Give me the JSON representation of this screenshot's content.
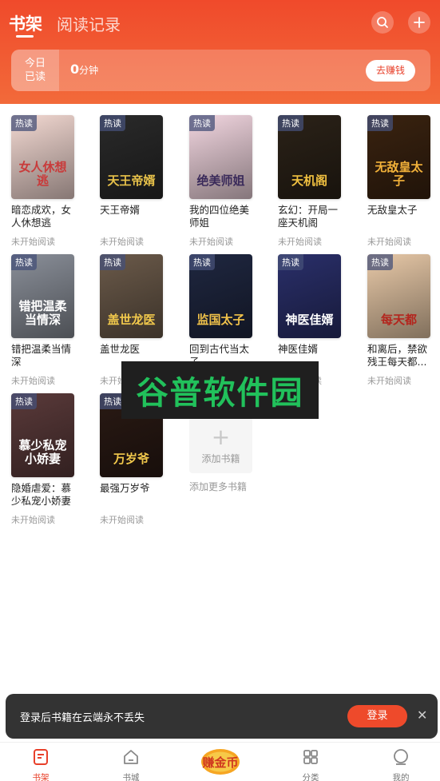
{
  "header": {
    "tab_bookshelf": "书架",
    "tab_history": "阅读记录",
    "today_line1": "今日",
    "today_line2": "已读",
    "minutes_value": "0",
    "minutes_unit": "分钟",
    "earn_button": "去赚钱",
    "search_icon": "search-icon",
    "add_icon": "plus-icon"
  },
  "books": [
    {
      "badge": "热读",
      "title": "暗恋成欢，女人休想逃",
      "status": "未开始阅读",
      "cover_text": "女人休想逃",
      "cover_colors": [
        "#f3d9d2",
        "#c93a3a"
      ]
    },
    {
      "badge": "热读",
      "title": "天王帝婿",
      "status": "未开始阅读",
      "cover_text": "天王帝婿",
      "cover_colors": [
        "#2a2a2a",
        "#e8c24a"
      ]
    },
    {
      "badge": "热读",
      "title": "我的四位绝美师姐",
      "status": "未开始阅读",
      "cover_text": "绝美师姐",
      "cover_colors": [
        "#f2d6e0",
        "#3a2a5a"
      ]
    },
    {
      "badge": "热读",
      "title": "玄幻：开局一座天机阁",
      "status": "未开始阅读",
      "cover_text": "天机阁",
      "cover_colors": [
        "#2b2218",
        "#f0c040"
      ]
    },
    {
      "badge": "热读",
      "title": "无敌皇太子",
      "status": "未开始阅读",
      "cover_text": "无敌皇太子",
      "cover_colors": [
        "#3a2310",
        "#f3b23a"
      ]
    },
    {
      "badge": "热读",
      "title": "错把温柔当情深",
      "status": "未开始阅读",
      "cover_text": "错把温柔当情深",
      "cover_colors": [
        "#8a8f99",
        "#ffffff"
      ]
    },
    {
      "badge": "热读",
      "title": "盖世龙医",
      "status": "未开始阅读",
      "cover_text": "盖世龙医",
      "cover_colors": [
        "#6b5a4a",
        "#f2c94c"
      ]
    },
    {
      "badge": "热读",
      "title": "回到古代当太子",
      "status": "未开始阅读",
      "cover_text": "监国太子",
      "cover_colors": [
        "#1f2740",
        "#f1c24a"
      ]
    },
    {
      "badge": "热读",
      "title": "神医佳婿",
      "status": "未开始阅读",
      "cover_text": "神医佳婿",
      "cover_colors": [
        "#2a2f6a",
        "#ffffff"
      ]
    },
    {
      "badge": "热读",
      "title": "和离后，禁欲残王每天都...",
      "status": "未开始阅读",
      "cover_text": "每天都",
      "cover_colors": [
        "#e8c9a8",
        "#b3261e"
      ]
    },
    {
      "badge": "热读",
      "title": "隐婚虐爱：慕少私宠小娇妻",
      "status": "未开始阅读",
      "cover_text": "慕少私宠小娇妻",
      "cover_colors": [
        "#5a3a3a",
        "#ffffff"
      ]
    },
    {
      "badge": "热读",
      "title": "最强万岁爷",
      "status": "未开始阅读",
      "cover_text": "万岁爷",
      "cover_colors": [
        "#2a1a14",
        "#f2c94c"
      ]
    }
  ],
  "add_book": {
    "label": "添加书籍",
    "more": "添加更多书籍"
  },
  "watermark": "谷普软件园",
  "login_prompt": {
    "text": "登录后书籍在云端永不丢失",
    "button": "登录"
  },
  "tabbar": {
    "items": [
      {
        "label": "书架",
        "icon": "bookshelf-icon"
      },
      {
        "label": "书城",
        "icon": "home-icon"
      },
      {
        "label": "赚金币",
        "icon": "coin-icon"
      },
      {
        "label": "分类",
        "icon": "grid-icon"
      },
      {
        "label": "我的",
        "icon": "user-icon"
      }
    ]
  },
  "colors": {
    "accent": "#ee4a2b",
    "header_top": "#f04a2b"
  }
}
